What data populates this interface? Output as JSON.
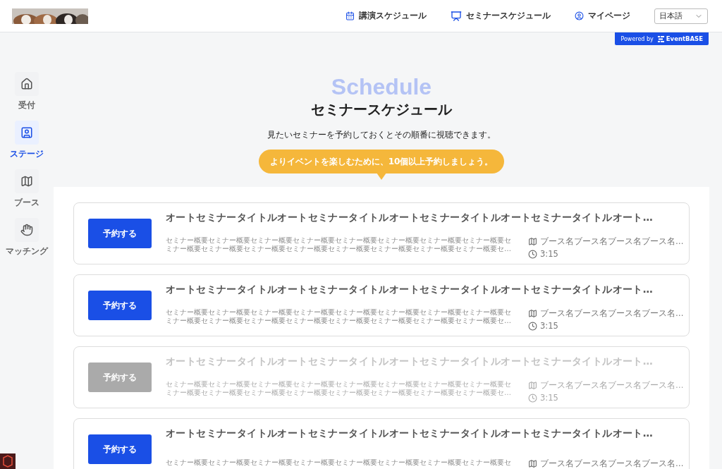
{
  "header": {
    "nav": [
      {
        "label": "講演スケジュール"
      },
      {
        "label": "セミナースケジュール"
      },
      {
        "label": "マイページ"
      }
    ],
    "language": "日本語",
    "powered_by": {
      "prefix": "Powered by",
      "brand": "EventBASE"
    }
  },
  "sidebar": {
    "items": [
      {
        "label": "受付",
        "selected": false
      },
      {
        "label": "ステージ",
        "selected": true
      },
      {
        "label": "ブース",
        "selected": false
      },
      {
        "label": "マッチング",
        "selected": false
      }
    ]
  },
  "heading": {
    "backdrop": "Schedule",
    "title": "セミナースケジュール",
    "subtitle": "見たいセミナーを予約しておくとその順番に視聴できます。",
    "callout": "よりイベントを楽しむために、10個以上予約しましょう。"
  },
  "seminars": [
    {
      "button": "予約する",
      "disabled": false,
      "title": "オートセミナータイトルオートセミナータイトルオートセミナータイトルオートセミナータイトルオート…",
      "description_lines": [
        "セミナー概要セミナー概要セミナー概要セミナー概要セミナー概要セミナー概要セミナー概要セミナー概要セ",
        "ミナー概要セミナー概要セミナー概要セミナー概要セミナー概要セミナー概要セミナー概要セミナー概要セ…"
      ],
      "booth": "ブース名ブース名ブース名ブース名…",
      "time": "3:15"
    },
    {
      "button": "予約する",
      "disabled": false,
      "title": "オートセミナータイトルオートセミナータイトルオートセミナータイトルオートセミナータイトルオート…",
      "description_lines": [
        "セミナー概要セミナー概要セミナー概要セミナー概要セミナー概要セミナー概要セミナー概要セミナー概要セ",
        "ミナー概要セミナー概要セミナー概要セミナー概要セミナー概要セミナー概要セミナー概要セミナー概要セ…"
      ],
      "booth": "ブース名ブース名ブース名ブース名…",
      "time": "3:15"
    },
    {
      "button": "予約する",
      "disabled": true,
      "title": "オートセミナータイトルオートセミナータイトルオートセミナータイトルオートセミナータイトルオート…",
      "description_lines": [
        "セミナー概要セミナー概要セミナー概要セミナー概要セミナー概要セミナー概要セミナー概要セミナー概要セ",
        "ミナー概要セミナー概要セミナー概要セミナー概要セミナー概要セミナー概要セミナー概要セミナー概要セ…"
      ],
      "booth": "ブース名ブース名ブース名ブース名…",
      "time": "3:15"
    },
    {
      "button": "予約する",
      "disabled": false,
      "title": "オートセミナータイトルオートセミナータイトルオートセミナータイトルオートセミナータイトルオート…",
      "description_lines": [
        "セミナー概要セミナー概要セミナー概要セミナー概要セミナー概要セミナー概要セミナー概要セミナー概要セ"
      ],
      "booth": "ブース名ブース名ブース名ブース名…"
    }
  ]
}
